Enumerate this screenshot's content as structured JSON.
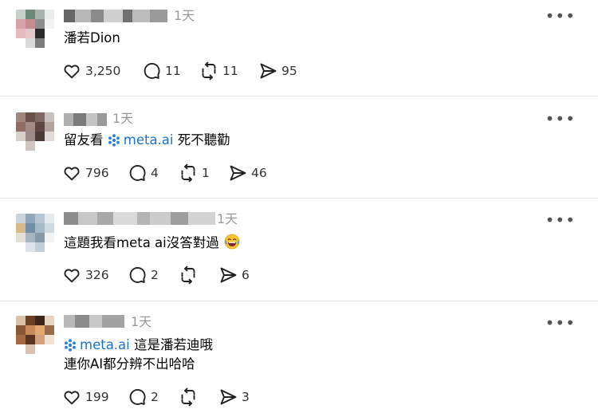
{
  "icons": {
    "like": "heart-icon",
    "reply": "comment-icon",
    "repost": "repost-icon",
    "share": "send-icon",
    "more": "more-icon",
    "mention": "meta-ai-icon",
    "emoji": "laughing-emoji-icon"
  },
  "colors": {
    "mention": "#1a74c9",
    "timestamp": "#999999",
    "divider": "#e5e5e5"
  },
  "more_label": "•••",
  "posts": [
    {
      "time": "1天",
      "lines": [
        "潘若Dion"
      ],
      "likes": "3,250",
      "replies": "11",
      "reposts": "11",
      "shares": "95"
    },
    {
      "time": "1天",
      "prefix": "留友看 ",
      "mention": "meta.ai",
      "suffix": " 死不聽勸",
      "likes": "796",
      "replies": "4",
      "reposts": "1",
      "shares": "46"
    },
    {
      "time": "1天",
      "text": "這題我看meta ai沒答對過",
      "likes": "326",
      "replies": "2",
      "reposts": "",
      "shares": "6"
    },
    {
      "time": "1天",
      "mention": "meta.ai",
      "suffix": " 這是潘若迪哦",
      "line2": "連你AI都分辨不出哈哈",
      "likes": "199",
      "replies": "2",
      "reposts": "",
      "shares": "3"
    }
  ]
}
